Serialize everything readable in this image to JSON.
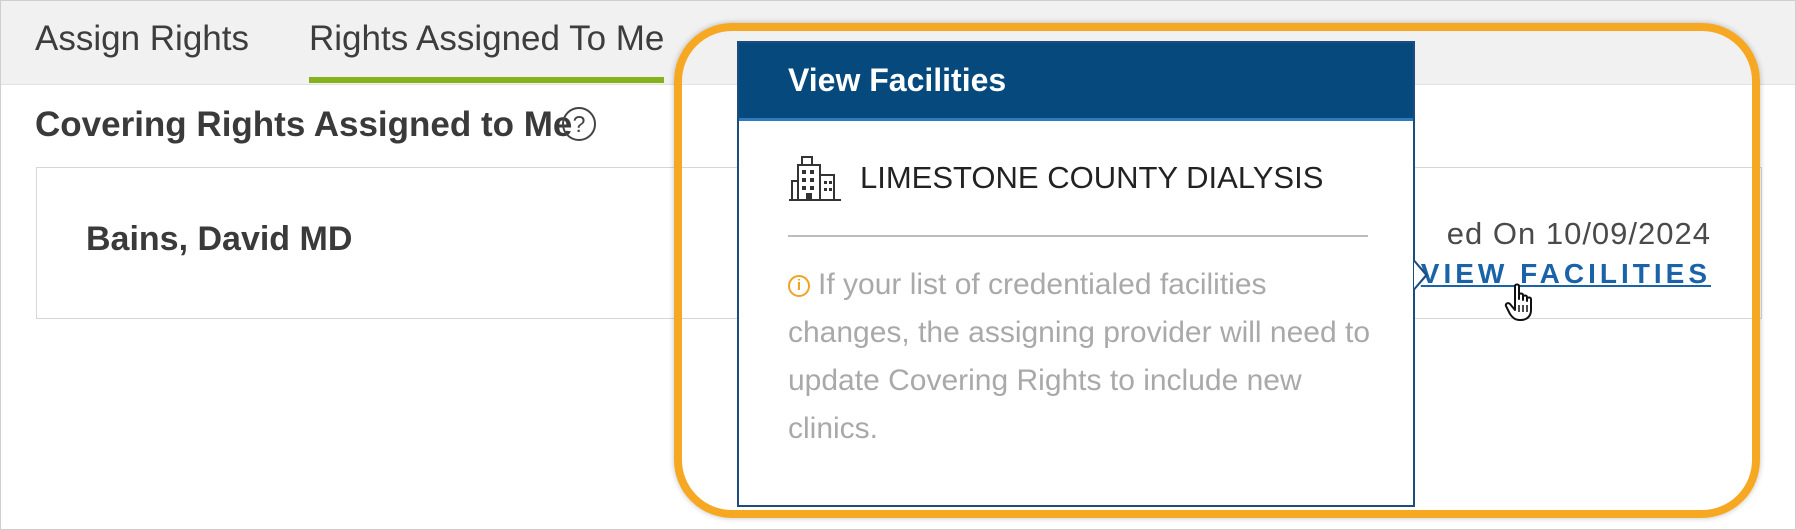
{
  "tabs": [
    {
      "label": "Assign Rights",
      "active": false
    },
    {
      "label": "Rights Assigned To Me",
      "active": true
    }
  ],
  "section": {
    "title": "Covering Rights Assigned to Me",
    "help_icon": "question-circle-icon"
  },
  "card": {
    "provider_name": "Bains, David MD",
    "assigned_on_visible": "ed On 10/09/2024",
    "view_facilities_link": "VIEW FACILITIES"
  },
  "popover": {
    "title": "View Facilities",
    "facility_icon": "building-icon",
    "facility_name": "LIMESTONE COUNTY DIALYSIS",
    "info_icon": "info-circle-icon",
    "info_text": "If your list of credentialed facilities changes, the assigning provider will need to update Covering Rights to include new clinics."
  },
  "colors": {
    "tab_active_underline": "#86b11c",
    "popover_header": "#05497d",
    "link": "#1a63a8",
    "highlight_ring": "#f7a823",
    "info_icon": "#f0a323"
  },
  "cursor": "hand-pointer-icon"
}
